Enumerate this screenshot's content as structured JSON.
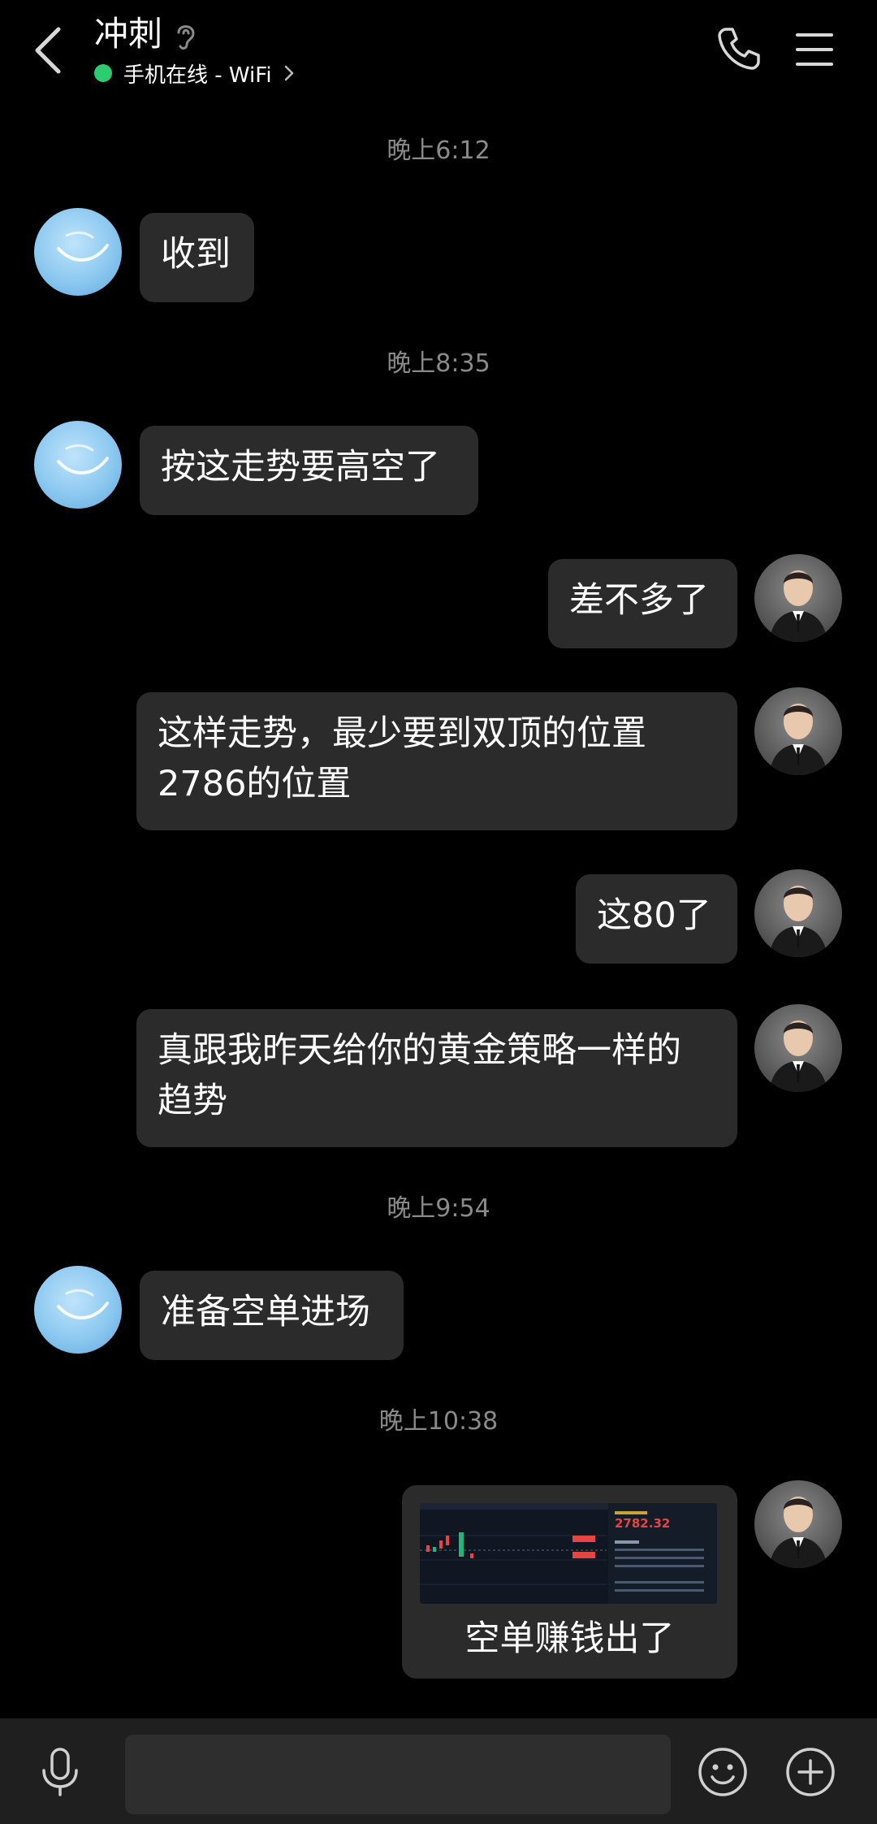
{
  "header": {
    "title": "冲刺",
    "status": "手机在线 - WiFi",
    "status_color": "#2ecc71"
  },
  "messages": {
    "ts1": "晚上6:12",
    "m1": "收到",
    "ts2": "晚上8:35",
    "m2": "按这走势要高空了",
    "m3": "差不多了",
    "m4_line1": "这样走势，最少要到双顶的位置",
    "m4_line2": "2786的位置",
    "m5": "这80了",
    "m6_line1": "真跟我昨天给你的黄金策略一样的",
    "m6_line2": "趋势",
    "ts3": "晚上9:54",
    "m7": "准备空单进场",
    "ts4": "晚上10:38",
    "m8_caption": "空单赚钱出了",
    "m8_image_price": "2782.32"
  },
  "icons": {
    "back": "back-arrow-icon",
    "ear": "ear-icon",
    "phone": "phone-icon",
    "menu": "menu-icon",
    "mic": "microphone-icon",
    "emoji": "emoji-icon",
    "plus": "plus-icon"
  },
  "colors": {
    "background": "#000000",
    "bubble": "#2b2b2b",
    "timestamp": "#8a8a8a",
    "online": "#2ecc71"
  }
}
